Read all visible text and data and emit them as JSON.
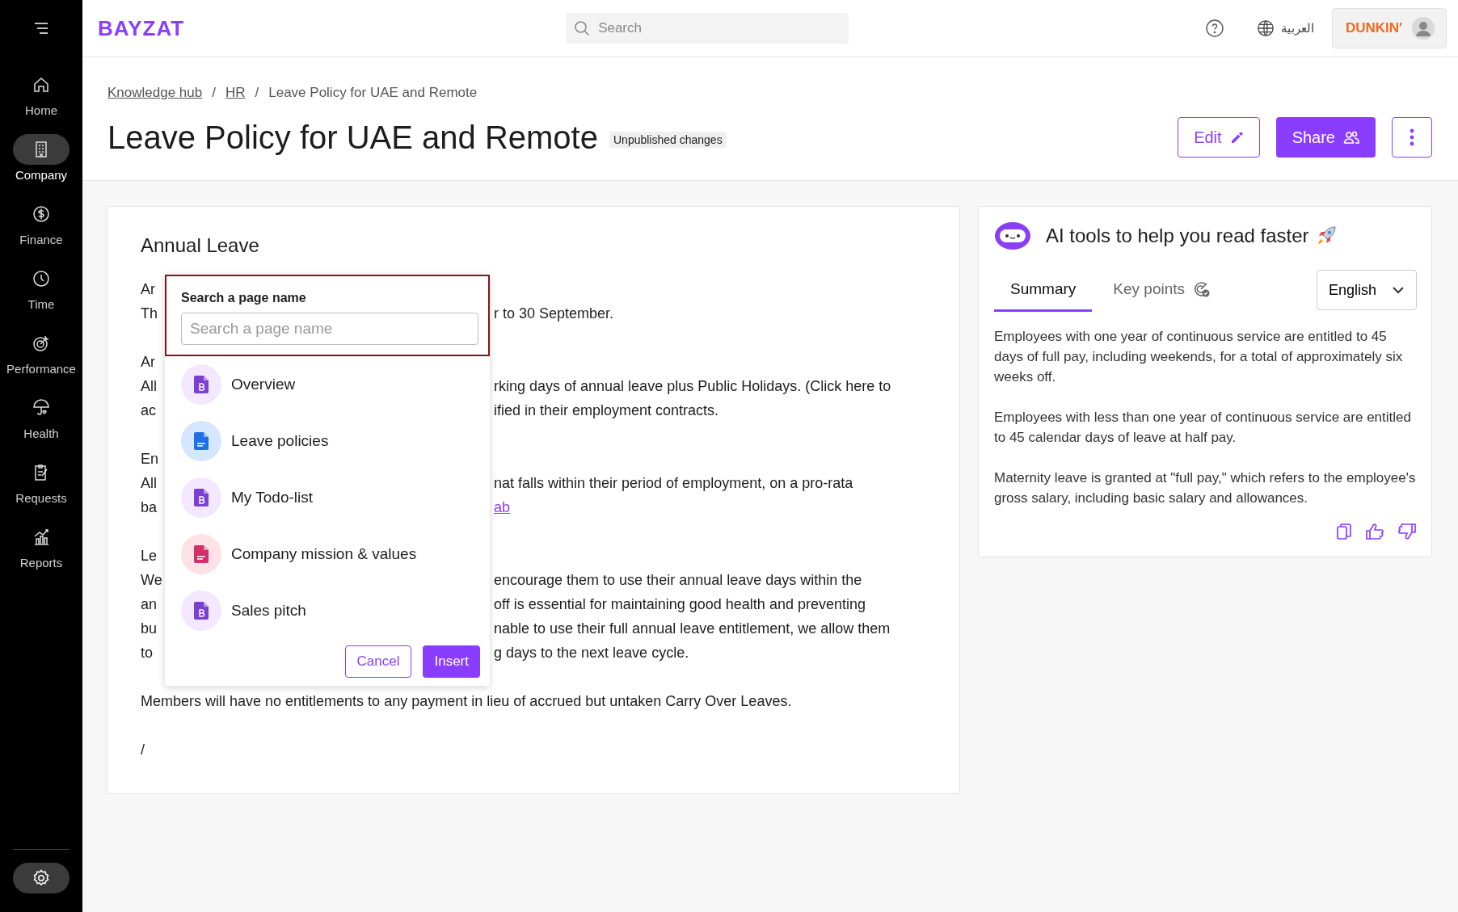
{
  "topbar": {
    "logo": "BAYZAT",
    "search": {
      "placeholder": "Search"
    },
    "language": "العربية",
    "company": "DUNKIN'"
  },
  "sidebar": {
    "items": [
      {
        "label": "Home",
        "selected": false
      },
      {
        "label": "Company",
        "selected": true
      },
      {
        "label": "Finance",
        "selected": false
      },
      {
        "label": "Time",
        "selected": false
      },
      {
        "label": "Performance",
        "selected": false
      },
      {
        "label": "Health",
        "selected": false
      },
      {
        "label": "Requests",
        "selected": false
      },
      {
        "label": "Reports",
        "selected": false
      }
    ]
  },
  "breadcrumbs": [
    {
      "label": "Knowledge hub",
      "kind": "link"
    },
    {
      "label": "/",
      "kind": "separator"
    },
    {
      "label": "HR",
      "kind": "link"
    },
    {
      "label": "/",
      "kind": "separator"
    },
    {
      "label": "Leave Policy for UAE and Remote",
      "kind": "current"
    }
  ],
  "page": {
    "title": "Leave Policy for UAE and Remote",
    "badge": "Unpublished changes",
    "buttons": {
      "edit": "Edit",
      "share": "Share"
    }
  },
  "document": {
    "heading": "Annual Leave",
    "paragraphs": [
      {
        "lines": [
          {
            "left": "Ar"
          },
          {
            "left": "Th",
            "right": "r to 30 September."
          }
        ]
      },
      {
        "lines": [
          {
            "left": "Ar"
          },
          {
            "left": "All",
            "right": "rking days of annual leave plus Public Holidays. (Click here to"
          },
          {
            "left": "ac",
            "right": "ified in their employment contracts."
          }
        ]
      },
      {
        "lines": [
          {
            "left": "En"
          },
          {
            "left": "All",
            "right": "nat falls within their period of employment, on a pro-rata"
          },
          {
            "left": "ba",
            "link": "ab"
          }
        ]
      },
      {
        "lines": [
          {
            "left": "Le"
          },
          {
            "left": "We",
            "right": "encourage them to use their annual leave days within the"
          },
          {
            "left": "an",
            "right": "off is essential for maintaining good health and preventing"
          },
          {
            "left": "bu",
            "right": "nable to use their full annual leave entitlement, we allow them"
          },
          {
            "left": "to",
            "right": "g days to the next leave cycle."
          }
        ]
      },
      {
        "lines": [
          {
            "left": "Members will have no entitlements to any payment in lieu of accrued but untaken Carry Over Leaves."
          }
        ]
      },
      {
        "lines": [
          {
            "left": "/"
          }
        ]
      }
    ]
  },
  "page_picker": {
    "label": "Search a page name",
    "placeholder": "Search a page name",
    "items": [
      {
        "name": "Overview",
        "kind": "page"
      },
      {
        "name": "Leave policies",
        "kind": "doc"
      },
      {
        "name": "My Todo-list",
        "kind": "page"
      },
      {
        "name": "Company mission & values",
        "kind": "pdf"
      },
      {
        "name": "Sales pitch",
        "kind": "page"
      }
    ],
    "cancel": "Cancel",
    "insert": "Insert"
  },
  "ai_panel": {
    "title": "AI tools to help you read faster",
    "tabs": [
      {
        "label": "Summary",
        "selected": true
      },
      {
        "label": "Key points",
        "selected": false
      }
    ],
    "language": "English",
    "paragraphs": [
      "Employees with one year of continuous service are entitled to 45 days of full pay, including weekends, for a total of approximately six weeks off.",
      "Employees with less than one year of continuous service are entitled to 45 calendar days of leave at half pay.",
      "Maternity leave is granted at \"full pay,\" which refers to the employee's gross salary, including basic salary and allowances."
    ]
  }
}
